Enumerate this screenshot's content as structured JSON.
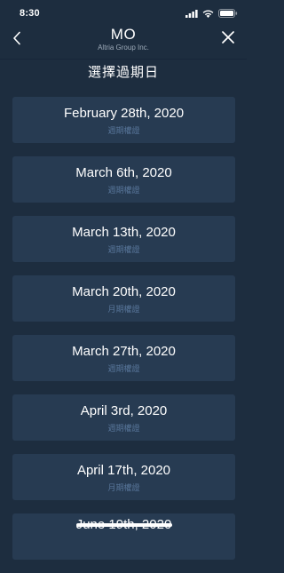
{
  "status_bar": {
    "time": "8:30",
    "icons": [
      "signal-icon",
      "wifi-icon",
      "battery-icon"
    ]
  },
  "nav": {
    "back_icon": "chevron-left-icon",
    "title": "MO",
    "subtitle": "Altria Group Inc.",
    "close_icon": "close-icon"
  },
  "page": {
    "title": "選擇過期日"
  },
  "dates": [
    {
      "label": "February 28th, 2020",
      "type": "週期權證"
    },
    {
      "label": "March 6th, 2020",
      "type": "週期權證"
    },
    {
      "label": "March 13th, 2020",
      "type": "週期權證"
    },
    {
      "label": "March 20th, 2020",
      "type": "月期權證"
    },
    {
      "label": "March 27th, 2020",
      "type": "週期權證"
    },
    {
      "label": "April 3rd, 2020",
      "type": "週期權證"
    },
    {
      "label": "April 17th, 2020",
      "type": "月期權證"
    },
    {
      "label": "June 19th, 2020",
      "type": ""
    }
  ],
  "colors": {
    "background": "#1d2d3f",
    "card": "#273b52",
    "subtext": "#58769a",
    "text": "#ffffff"
  }
}
